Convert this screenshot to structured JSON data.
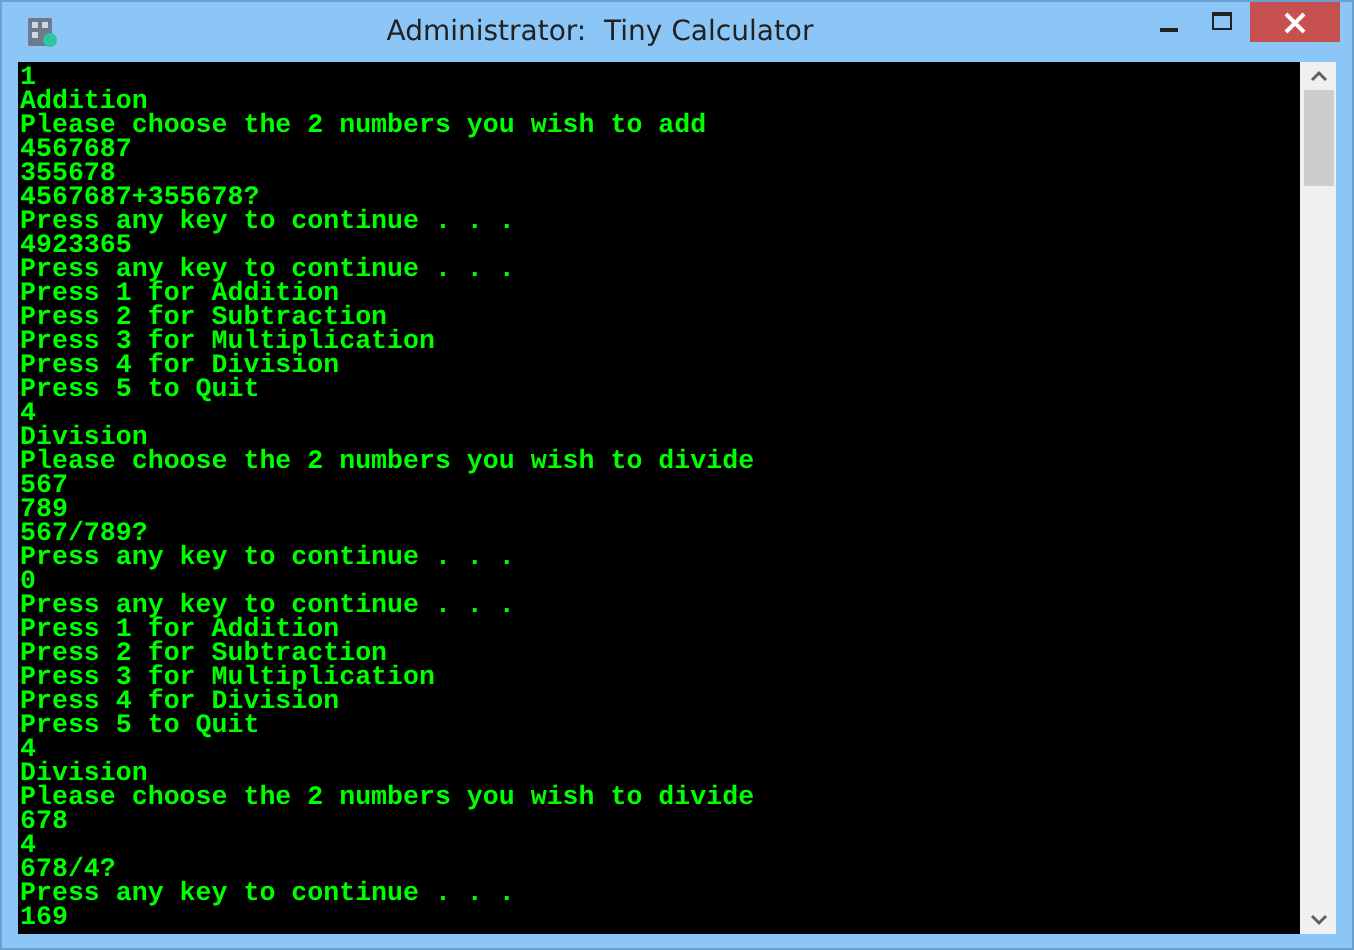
{
  "window": {
    "title": "Administrator:  Tiny Calculator"
  },
  "console": {
    "lines": [
      "1",
      "Addition",
      "Please choose the 2 numbers you wish to add",
      "4567687",
      "355678",
      "4567687+355678?",
      "Press any key to continue . . .",
      "4923365",
      "Press any key to continue . . .",
      "Press 1 for Addition",
      "Press 2 for Subtraction",
      "Press 3 for Multiplication",
      "Press 4 for Division",
      "Press 5 to Quit",
      "4",
      "Division",
      "Please choose the 2 numbers you wish to divide",
      "567",
      "789",
      "567/789?",
      "Press any key to continue . . .",
      "0",
      "Press any key to continue . . .",
      "Press 1 for Addition",
      "Press 2 for Subtraction",
      "Press 3 for Multiplication",
      "Press 4 for Division",
      "Press 5 to Quit",
      "4",
      "Division",
      "Please choose the 2 numbers you wish to divide",
      "678",
      "4",
      "678/4?",
      "Press any key to continue . . .",
      "169"
    ]
  }
}
